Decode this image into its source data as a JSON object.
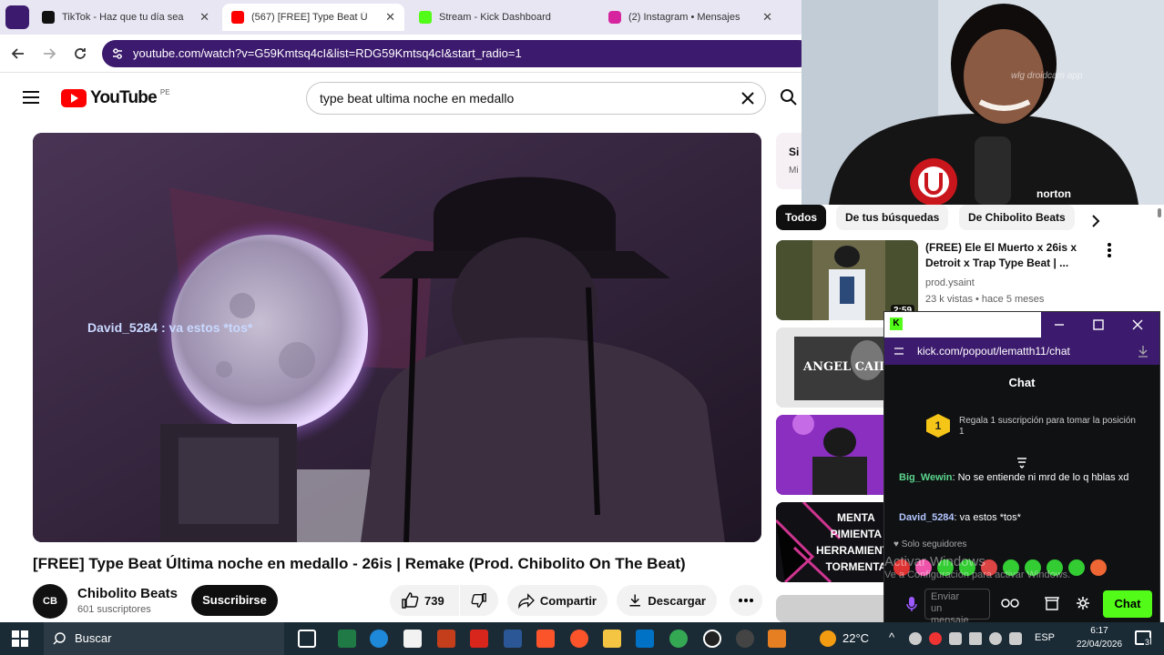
{
  "browser": {
    "tabs": [
      {
        "label": "TikTok - Haz que tu día sea",
        "color": "#111111"
      },
      {
        "label": "(567) [FREE] Type Beat Ú",
        "color": "#ff0000"
      },
      {
        "label": "Stream - Kick Dashboard",
        "color": "#53fc18"
      },
      {
        "label": "(2) Instagram • Mensajes",
        "color": "#d6249f"
      }
    ],
    "close_glyph": "✕",
    "url": "youtube.com/watch?v=G59Kmtsq4cI&list=RDG59Kmtsq4cI&start_radio=1"
  },
  "youtube": {
    "logo_text": "YouTube",
    "country": "PE",
    "search_value": "type beat ultima noche en medallo",
    "overlay_text": "David_5284 : va estos *tos*",
    "video_title": "[FREE] Type Beat Última noche en medallo - 26is | Remake (Prod. Chibolito On The Beat)",
    "channel": {
      "name": "Chibolito Beats",
      "subs": "601 suscriptores",
      "avatar": "CB",
      "subscribe": "Suscribirse"
    },
    "actions": {
      "likes": "739",
      "share": "Compartir",
      "download": "Descargar"
    },
    "chips": [
      "Todos",
      "De tus búsquedas",
      "De Chibolito Beats"
    ],
    "promo_partial": [
      "Si",
      "Mi"
    ],
    "rec": [
      {
        "title": "(FREE) Ele El Muerto x 26is x Detroit x Trap Type Beat | ...",
        "channel": "prod.ysaint",
        "meta": "23 k vistas • hace 5 meses",
        "duration": "2:59"
      }
    ],
    "thumb_texts": [
      "ANGEL CAIDO",
      "MENTA\nPIMIENTA\nHERRAMIENTA\nTORMENTA"
    ]
  },
  "kick": {
    "url": "kick.com/popout/lematth11/chat",
    "header": "Chat",
    "gift_rank": "1",
    "gift_text": "Regala 1 suscripción para tomar la posición 1",
    "messages": [
      {
        "user": "Big_Wewin",
        "text": "No se entiende ni mrd de lo q hblas xd",
        "color": "#5bd48c"
      },
      {
        "user": "David_5284",
        "text": "va estos *tos*",
        "color": "#b4c6ff"
      }
    ],
    "followers_only": "Solo seguidores",
    "input_placeholder": "Enviar un mensaje",
    "chat_button": "Chat",
    "watermark_line1": "Activar Windows",
    "watermark_line2": "Ve a Configuración para activar Windows."
  },
  "webcam": {
    "overlay": "wlg droidcam app",
    "shirt_text": "norton"
  },
  "taskbar": {
    "search": "Buscar",
    "temperature": "22°C",
    "lang": "ESP",
    "time": "6:17",
    "date": "22/04/2026",
    "notif": "3"
  }
}
